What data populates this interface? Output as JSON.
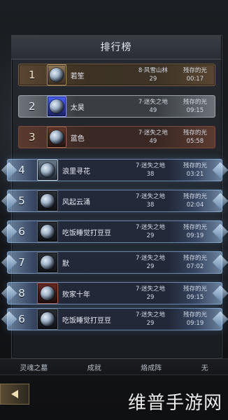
{
  "panel": {
    "title": "排行榜"
  },
  "rows": [
    {
      "rank": "1",
      "name": "若笙",
      "map": "8·风雪山林",
      "level": "29",
      "label": "残存的光",
      "time": "00:17",
      "style": "gold",
      "avatar": "gold"
    },
    {
      "rank": "2",
      "name": "太昊",
      "map": "7·迷失之地",
      "level": "49",
      "label": "残存的光",
      "time": "09:15",
      "style": "silver",
      "avatar": "blue"
    },
    {
      "rank": "3",
      "name": "蓝色",
      "map": "7·迷失之地",
      "level": "49",
      "label": "残存的光",
      "time": "05:58",
      "style": "bronze",
      "avatar": "bronze"
    },
    {
      "rank": "4",
      "name": "浪里寻花",
      "map": "7·迷失之地",
      "level": "38",
      "label": "残存的光",
      "time": "03:21",
      "style": "ice",
      "avatar": "silver"
    },
    {
      "rank": "5",
      "name": "风起云涌",
      "map": "7·迷失之地",
      "level": "38",
      "label": "残存的光",
      "time": "02:04",
      "style": "ice",
      "avatar": "dark"
    },
    {
      "rank": "6",
      "name": "吃饭睡觉打豆豆",
      "map": "7·迷失之地",
      "level": "29",
      "label": "残存的光",
      "time": "09:19",
      "style": "ice",
      "avatar": "dark"
    },
    {
      "rank": "7",
      "name": "默",
      "map": "7·迷失之地",
      "level": "29",
      "label": "残存的光",
      "time": "07:02",
      "style": "ice",
      "avatar": "dark"
    },
    {
      "rank": "8",
      "name": "败家十年",
      "map": "7·迷失之地",
      "level": "29",
      "label": "残存的光",
      "time": "09:15",
      "style": "ice",
      "avatar": "red"
    },
    {
      "rank": "6",
      "name": "吃饭睡觉打豆豆",
      "map": "7·迷失之地",
      "level": "29",
      "label": "残存的光",
      "time": "09:19",
      "style": "ice",
      "avatar": "dark"
    }
  ],
  "tabs": {
    "items": [
      "灵魂之墓",
      "成就",
      "烙成阵",
      "无"
    ]
  },
  "watermark": "维普手游网"
}
